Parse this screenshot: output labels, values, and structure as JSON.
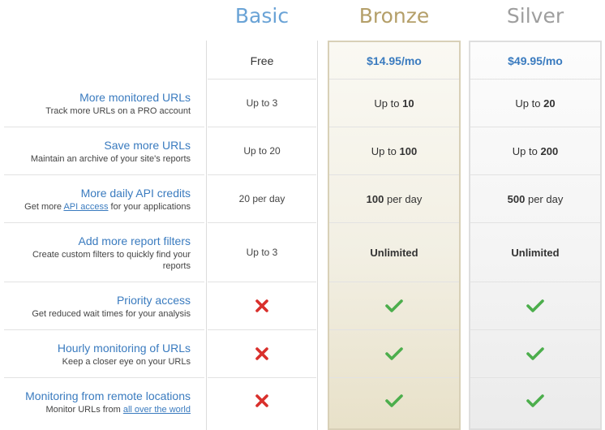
{
  "plans": [
    {
      "name": "Basic",
      "price": "Free",
      "color": "#6aa3d6"
    },
    {
      "name": "Bronze",
      "price": "$14.95/mo",
      "color": "#b49f69"
    },
    {
      "name": "Silver",
      "price": "$49.95/mo",
      "color": "#9e9e9e"
    }
  ],
  "features": [
    {
      "title": "More monitored URLs",
      "desc": "Track more URLs on a PRO account",
      "basic": "Up to 3",
      "bronze_pre": "Up to ",
      "bronze_val": "10",
      "silver_pre": "Up to ",
      "silver_val": "20"
    },
    {
      "title": "Save more URLs",
      "desc": "Maintain an archive of your site's reports",
      "basic": "Up to 20",
      "bronze_pre": "Up to ",
      "bronze_val": "100",
      "silver_pre": "Up to ",
      "silver_val": "200"
    },
    {
      "title": "More daily API credits",
      "desc_pre": "Get more ",
      "desc_link": "API access",
      "desc_post": " for your applications",
      "basic": "20 per day",
      "bronze_val": "100",
      "bronze_post": " per day",
      "silver_val": "500",
      "silver_post": " per day"
    },
    {
      "title": "Add more report filters",
      "desc": "Create custom filters to quickly find your reports",
      "basic": "Up to 3",
      "bronze": "Unlimited",
      "silver": "Unlimited"
    },
    {
      "title": "Priority access",
      "desc": "Get reduced wait times for your analysis",
      "basic": "cross-icon",
      "bronze": "check-icon",
      "silver": "check-icon"
    },
    {
      "title": "Hourly monitoring of URLs",
      "desc": "Keep a closer eye on your URLs",
      "basic": "cross-icon",
      "bronze": "check-icon",
      "silver": "check-icon"
    },
    {
      "title": "Monitoring from remote locations",
      "desc_pre": "Monitor URLs from ",
      "desc_link": "all over the world",
      "basic": "cross-icon",
      "bronze": "check-icon",
      "silver": "check-icon"
    }
  ],
  "colors": {
    "check": "#4cae4c",
    "cross": "#d9302c",
    "link": "#3a7bbf"
  }
}
